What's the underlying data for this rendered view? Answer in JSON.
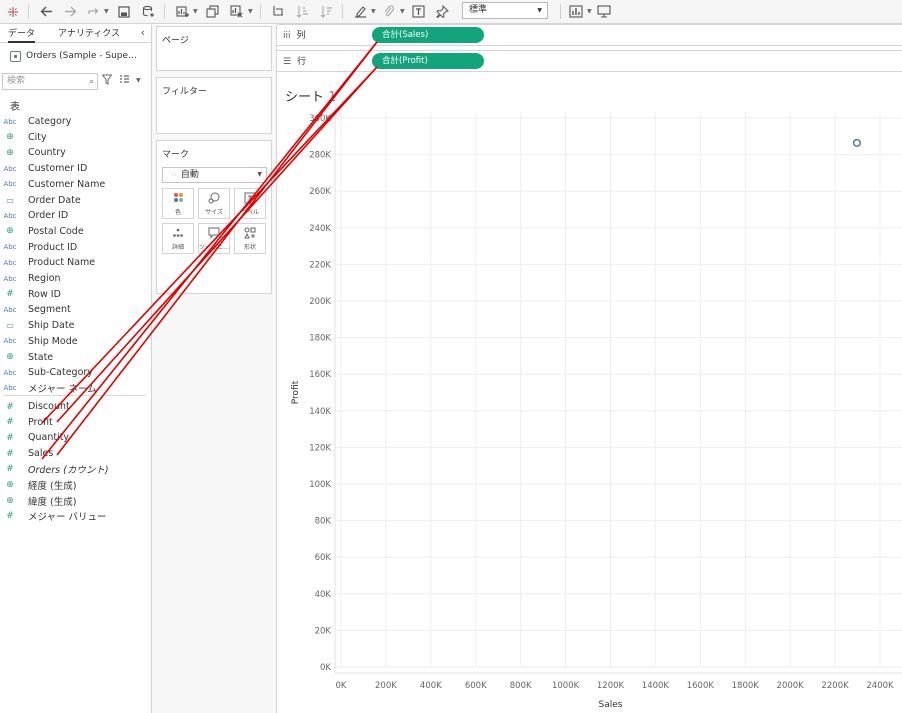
{
  "toolbar": {
    "fit_value": "標準",
    "icons": [
      "tableau-logo-icon",
      "undo-icon",
      "redo-icon",
      "replay-icon",
      "save-icon",
      "new-datasource-icon",
      "new-sheet-icon",
      "duplicate-icon",
      "clear-sheet-icon",
      "swap-axes-icon",
      "sort-ascending-icon",
      "sort-descending-icon",
      "highlight-icon",
      "group-icon",
      "label-icon",
      "pin-icon",
      "show-me-icon",
      "presentation-icon"
    ]
  },
  "data_pane": {
    "tab_data": "データ",
    "tab_analytics": "アナリティクス",
    "datasource": "Orders (Sample - Supe…",
    "search_placeholder": "検索",
    "section_title": "表",
    "dimensions": [
      {
        "type": "Abc",
        "name": "Category"
      },
      {
        "type": "geo",
        "name": "City"
      },
      {
        "type": "geo",
        "name": "Country"
      },
      {
        "type": "Abc",
        "name": "Customer ID"
      },
      {
        "type": "Abc",
        "name": "Customer Name"
      },
      {
        "type": "date",
        "name": "Order Date"
      },
      {
        "type": "Abc",
        "name": "Order ID"
      },
      {
        "type": "geo",
        "name": "Postal Code"
      },
      {
        "type": "Abc",
        "name": "Product ID"
      },
      {
        "type": "Abc",
        "name": "Product Name"
      },
      {
        "type": "Abc",
        "name": "Region"
      },
      {
        "type": "#",
        "name": "Row ID"
      },
      {
        "type": "Abc",
        "name": "Segment"
      },
      {
        "type": "date",
        "name": "Ship Date"
      },
      {
        "type": "Abc",
        "name": "Ship Mode"
      },
      {
        "type": "geo",
        "name": "State"
      },
      {
        "type": "Abc",
        "name": "Sub-Category"
      },
      {
        "type": "Abc",
        "name": "メジャー ネーム"
      }
    ],
    "measures": [
      {
        "type": "#",
        "name": "Discount",
        "italic": false
      },
      {
        "type": "#",
        "name": "Profit",
        "italic": false
      },
      {
        "type": "#",
        "name": "Quantity",
        "italic": false
      },
      {
        "type": "#",
        "name": "Sales",
        "italic": false
      },
      {
        "type": "#",
        "name": "Orders (カウント)",
        "italic": true
      },
      {
        "type": "geo",
        "name": "経度 (生成)",
        "italic": false
      },
      {
        "type": "geo",
        "name": "緯度 (生成)",
        "italic": false
      },
      {
        "type": "#",
        "name": "メジャー バリュー",
        "italic": false
      }
    ]
  },
  "cards": {
    "pages_title": "ページ",
    "filters_title": "フィルター",
    "marks_title": "マーク",
    "mark_type": "自動",
    "mark_buttons": [
      {
        "label": "色",
        "icon": "color-icon"
      },
      {
        "label": "サイズ",
        "icon": "size-icon"
      },
      {
        "label": "ラベル",
        "icon": "label-icon"
      },
      {
        "label": "詳細",
        "icon": "detail-icon"
      },
      {
        "label": "ツールヒ…",
        "icon": "tooltip-icon"
      },
      {
        "label": "形状",
        "icon": "shape-icon"
      }
    ]
  },
  "shelves": {
    "columns_label": "列",
    "rows_label": "行",
    "columns_pill": "合計(Sales)",
    "rows_pill": "合計(Profit)"
  },
  "sheet": {
    "title": "シート",
    "title_num": "1"
  },
  "chart_data": {
    "type": "scatter",
    "xlabel": "Sales",
    "ylabel": "Profit",
    "xlim": [
      0,
      2400000
    ],
    "ylim": [
      0,
      300000
    ],
    "x_ticks": [
      "0K",
      "200K",
      "400K",
      "600K",
      "800K",
      "1000K",
      "1200K",
      "1400K",
      "1600K",
      "1800K",
      "2000K",
      "2200K",
      "2400K"
    ],
    "y_ticks": [
      "0K",
      "20K",
      "40K",
      "60K",
      "80K",
      "100K",
      "120K",
      "140K",
      "160K",
      "180K",
      "200K",
      "220K",
      "240K",
      "260K",
      "280K",
      "300K"
    ],
    "points": [
      {
        "x": 2297201,
        "y": 286397
      }
    ],
    "grid": true,
    "marker": "open-circle",
    "marker_color": "#4e79a7"
  },
  "annotation": {
    "color": "#e00000"
  }
}
